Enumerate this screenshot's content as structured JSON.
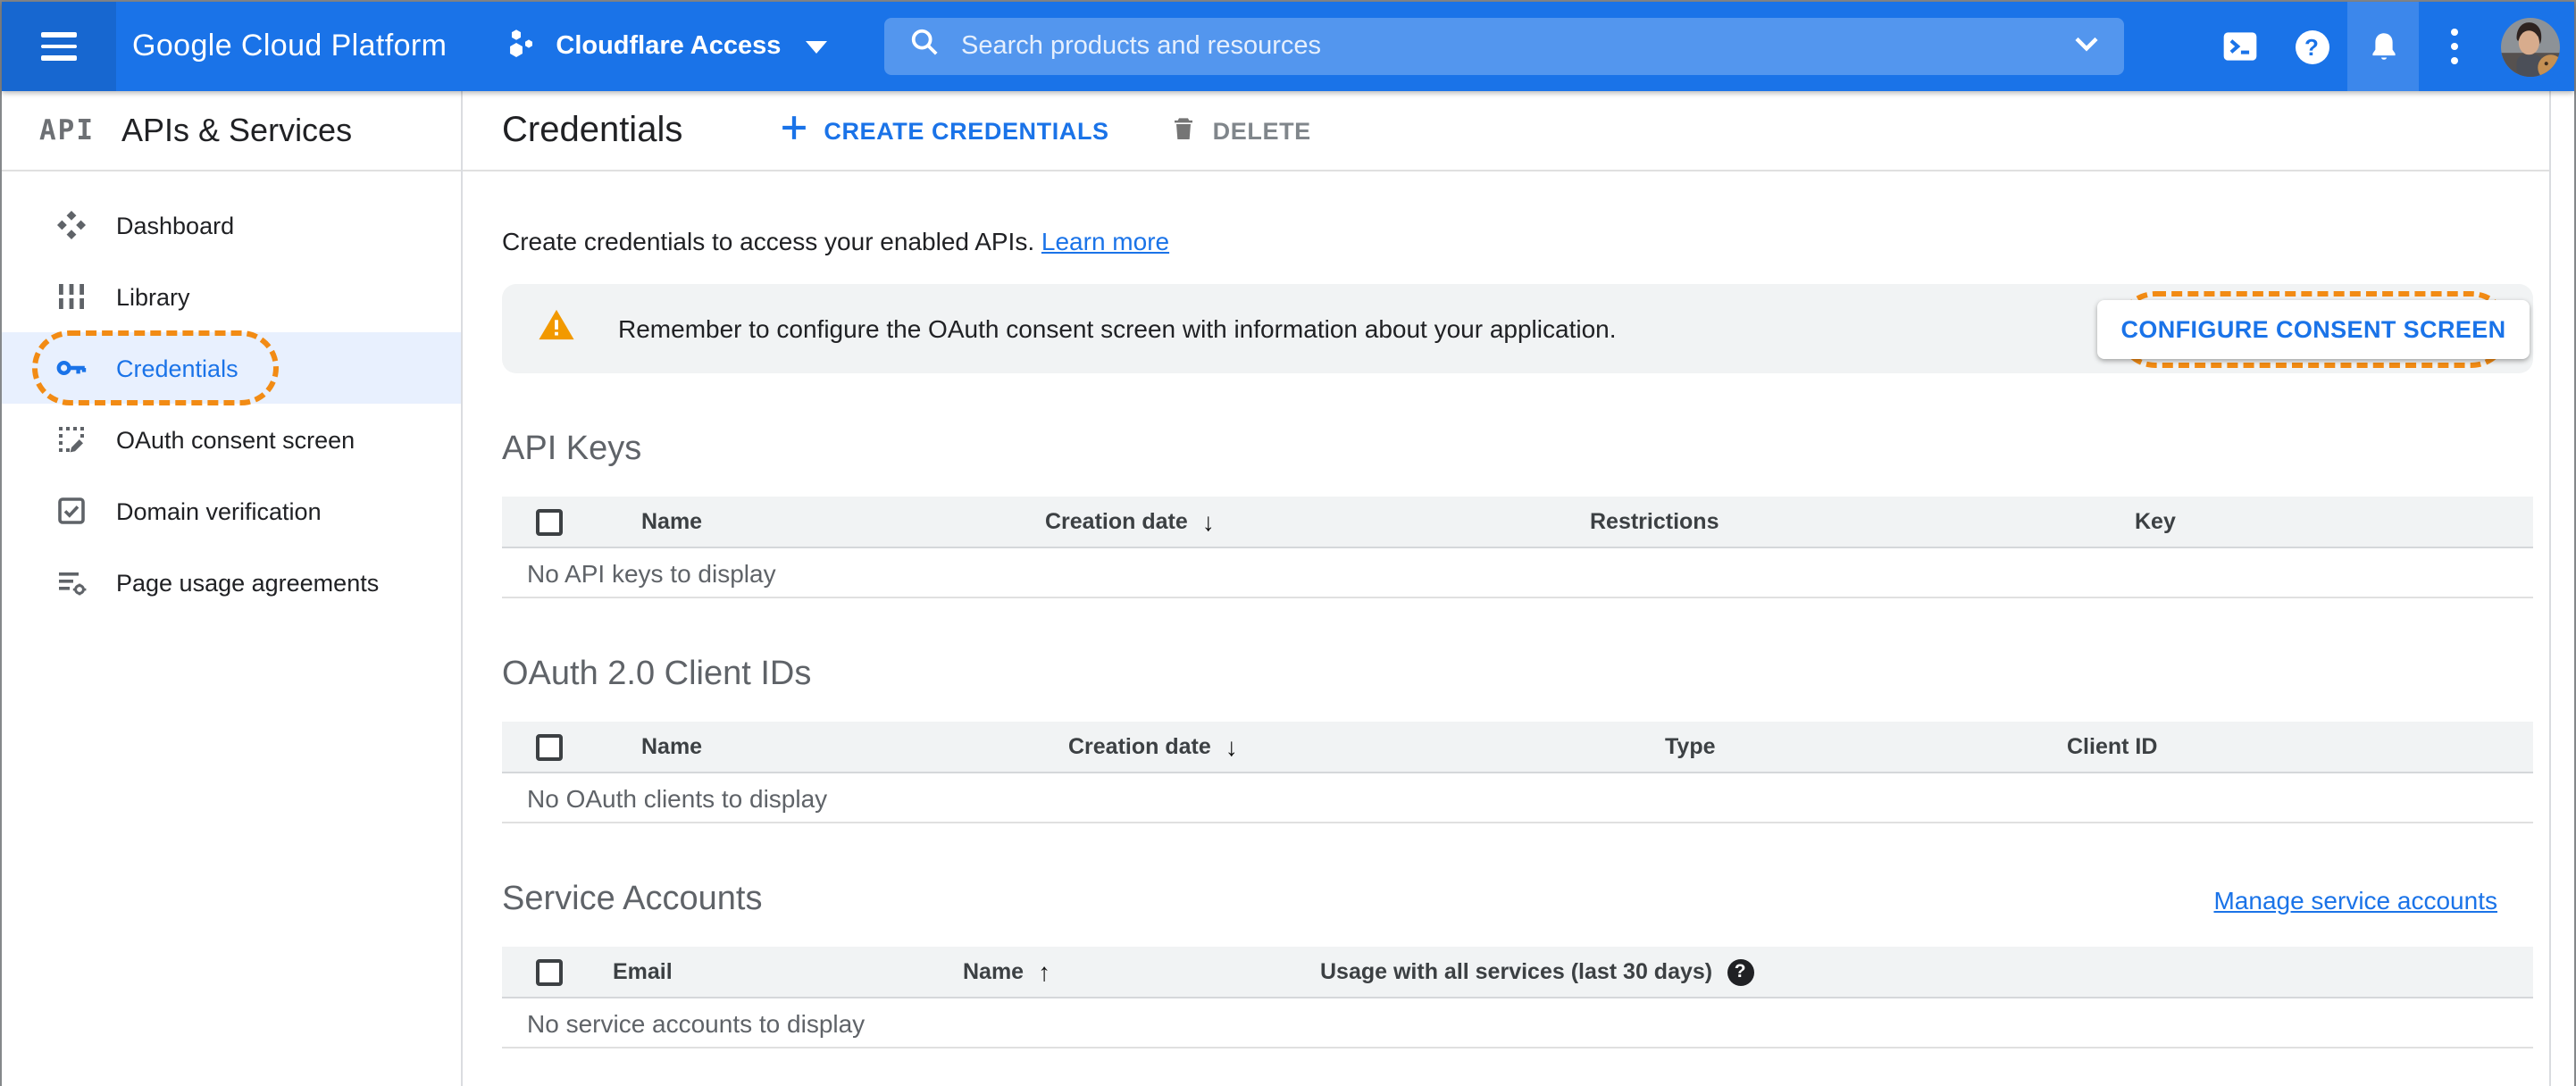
{
  "topbar": {
    "brand": "Google Cloud Platform",
    "project": "Cloudflare Access",
    "search_placeholder": "Search products and resources"
  },
  "sidebar": {
    "product_logo": "API",
    "product_name": "APIs & Services",
    "items": [
      {
        "label": "Dashboard"
      },
      {
        "label": "Library"
      },
      {
        "label": "Credentials",
        "active": true,
        "annotated": true
      },
      {
        "label": "OAuth consent screen"
      },
      {
        "label": "Domain verification"
      },
      {
        "label": "Page usage agreements"
      }
    ]
  },
  "header": {
    "title": "Credentials",
    "create_button": "CREATE CREDENTIALS",
    "delete_button": "DELETE"
  },
  "main": {
    "intro": "Create credentials to access your enabled APIs.",
    "learn_more": "Learn more",
    "banner": {
      "text": "Remember to configure the OAuth consent screen with information about your application.",
      "button": "CONFIGURE CONSENT SCREEN"
    },
    "sections": {
      "api_keys": {
        "title": "API Keys",
        "columns": [
          "Name",
          "Creation date",
          "Restrictions",
          "Key"
        ],
        "sort": {
          "column": "Creation date",
          "direction": "desc"
        },
        "empty": "No API keys to display"
      },
      "oauth": {
        "title": "OAuth 2.0 Client IDs",
        "columns": [
          "Name",
          "Creation date",
          "Type",
          "Client ID"
        ],
        "sort": {
          "column": "Creation date",
          "direction": "desc"
        },
        "empty": "No OAuth clients to display"
      },
      "service_accounts": {
        "title": "Service Accounts",
        "link": "Manage service accounts",
        "columns": [
          "Email",
          "Name",
          "Usage with all services (last 30 days)"
        ],
        "sort": {
          "column": "Name",
          "direction": "asc"
        },
        "empty": "No service accounts to display"
      }
    }
  },
  "colors": {
    "accent_blue": "#1a73e8",
    "annotation_orange": "#f28b14",
    "warning_orange": "#f29900",
    "banner_gray": "#f1f3f4"
  }
}
